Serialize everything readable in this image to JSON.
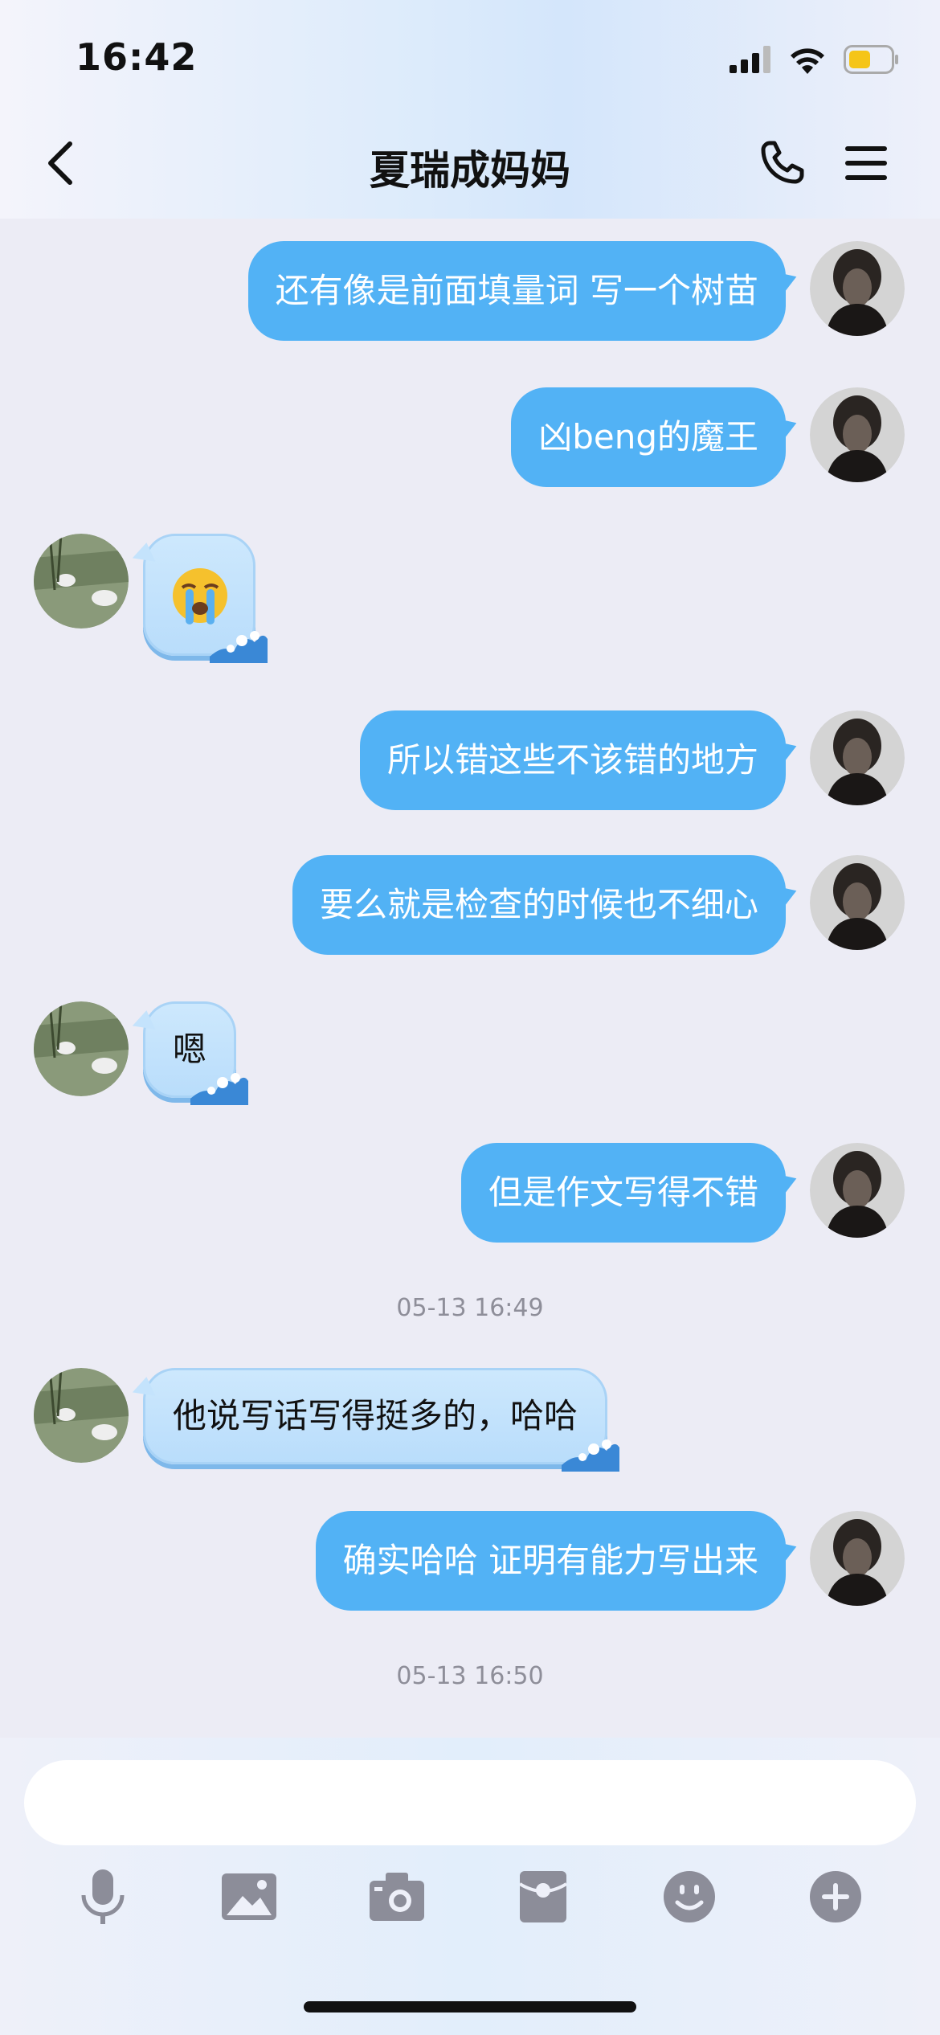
{
  "status_bar": {
    "time": "16:42"
  },
  "nav": {
    "title": "夏瑞成妈妈"
  },
  "messages": [
    {
      "from": "me",
      "text": "还有像是前面填量词 写一个树苗"
    },
    {
      "from": "me",
      "text": "凶beng的魔王"
    },
    {
      "from": "them",
      "emoji": "loudly-crying-face"
    },
    {
      "from": "me",
      "text": "所以错这些不该错的地方"
    },
    {
      "from": "me",
      "text": "要么就是检查的时候也不细心"
    },
    {
      "from": "them",
      "text": "嗯"
    },
    {
      "from": "me",
      "text": "但是作文写得不错"
    },
    {
      "from": "them",
      "text": "他说写话写得挺多的，哈哈"
    },
    {
      "from": "me",
      "text": "确实哈哈 证明有能力写出来"
    }
  ],
  "timestamps": [
    "05-13 16:49",
    "05-13 16:50"
  ],
  "input": {
    "placeholder": ""
  },
  "toolbar": [
    "microphone-icon",
    "image-icon",
    "camera-icon",
    "red-packet-icon",
    "emoji-icon",
    "plus-icon"
  ],
  "colors": {
    "my_bubble": "#52b2f5",
    "their_bubble": "#c4e3fc",
    "background": "#ececf5"
  }
}
